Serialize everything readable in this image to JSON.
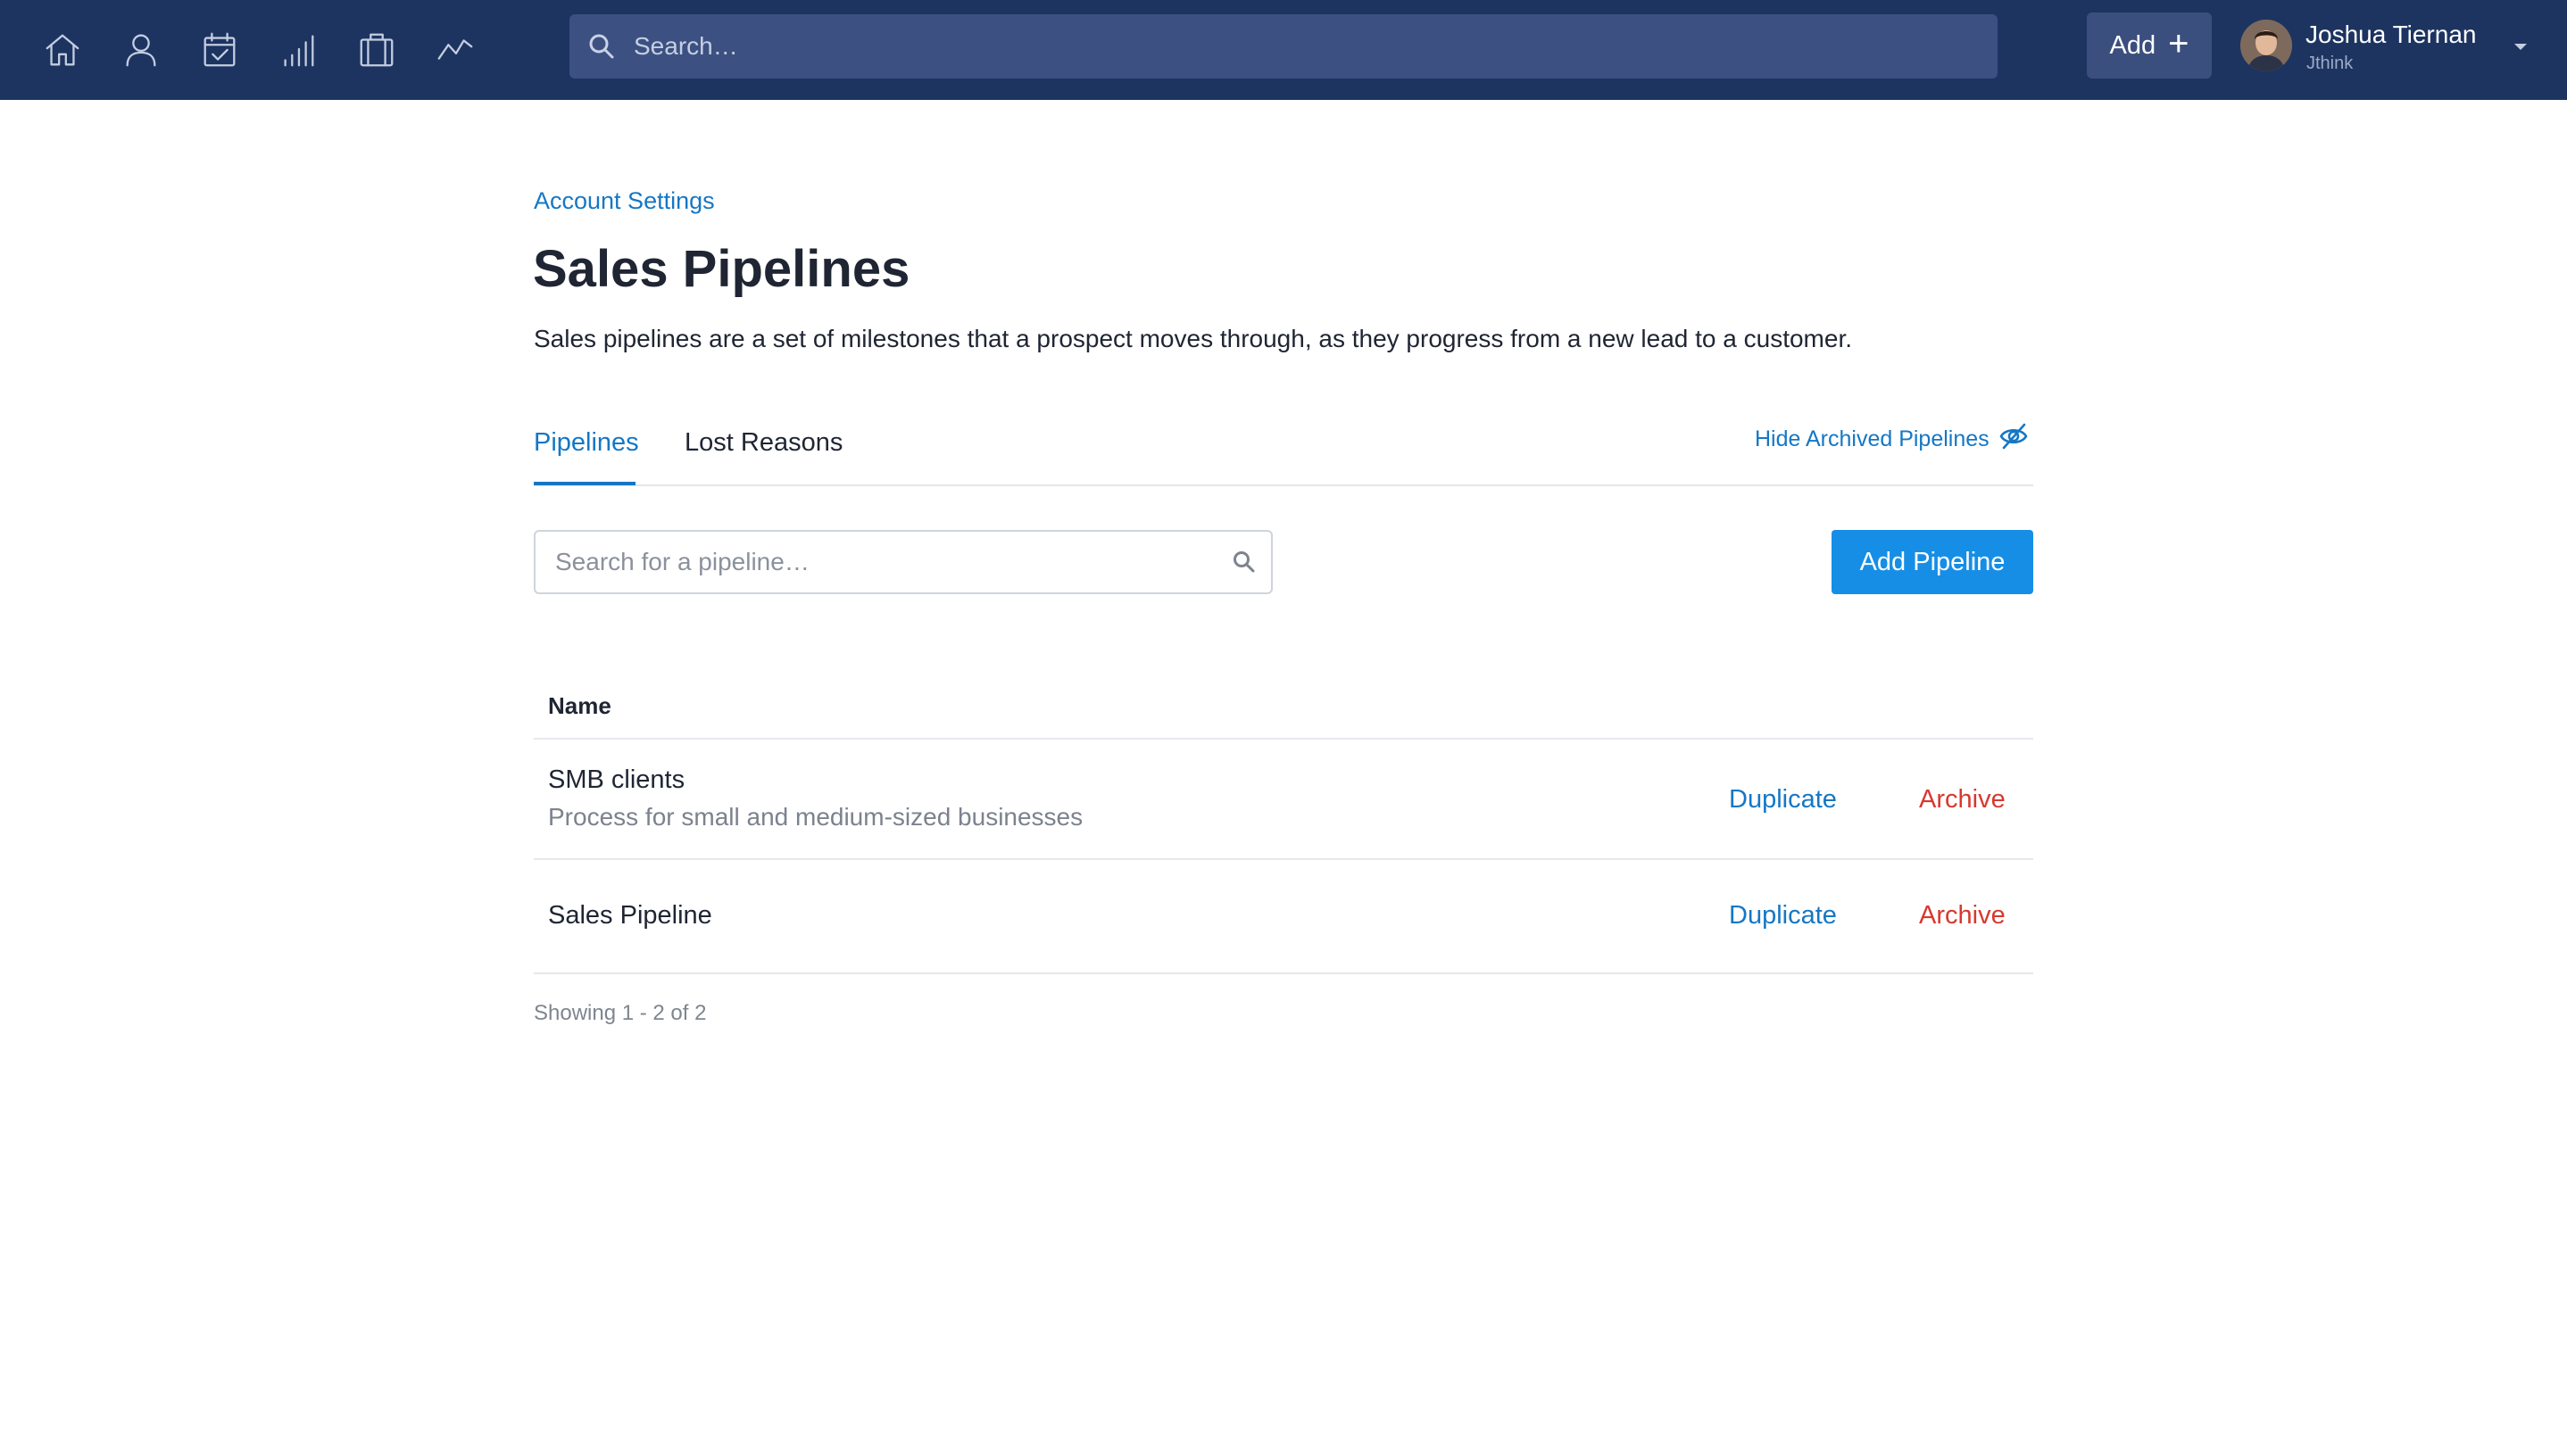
{
  "nav": {
    "icons": [
      "home-icon",
      "contacts-icon",
      "tasks-icon",
      "reports-icon",
      "deals-icon",
      "activity-icon"
    ],
    "search_placeholder": "Search…",
    "add_label": "Add",
    "user_name": "Joshua Tiernan",
    "user_org": "Jthink"
  },
  "breadcrumb": "Account Settings",
  "page": {
    "title": "Sales Pipelines",
    "description": "Sales pipelines are a set of milestones that a prospect moves through, as they progress from a new lead to a customer."
  },
  "tabs": [
    {
      "label": "Pipelines",
      "active": true
    },
    {
      "label": "Lost Reasons",
      "active": false
    }
  ],
  "hide_archived_label": "Hide Archived Pipelines",
  "pipeline_search_placeholder": "Search for a pipeline…",
  "add_pipeline_label": "Add Pipeline",
  "table": {
    "header_name": "Name",
    "rows": [
      {
        "name": "SMB clients",
        "description": "Process for small and medium-sized businesses",
        "duplicate": "Duplicate",
        "archive": "Archive"
      },
      {
        "name": "Sales Pipeline",
        "description": "",
        "duplicate": "Duplicate",
        "archive": "Archive"
      }
    ]
  },
  "pagination": "Showing 1 - 2 of 2",
  "colors": {
    "nav_bg": "#1d3461",
    "accent": "#1577c5",
    "primary_button": "#168ee6",
    "danger": "#d6392f"
  }
}
